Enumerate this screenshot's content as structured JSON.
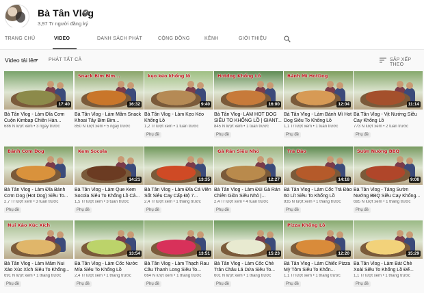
{
  "channel": {
    "name": "Bà Tân Vlog",
    "subscribers": "3,97 Tr người đăng ký",
    "verified_glyph": "✔"
  },
  "tabs": [
    {
      "label": "TRANG CHỦ"
    },
    {
      "label": "VIDEO"
    },
    {
      "label": "DANH SÁCH PHÁT"
    },
    {
      "label": "CỘNG ĐỒNG"
    },
    {
      "label": "KÊNH"
    },
    {
      "label": "GIỚI THIỆU"
    }
  ],
  "active_tab": "VIDEO",
  "subheader": {
    "uploads_label": "Video tải lên",
    "play_all": "PHÁT TẤT CẢ",
    "sort_label": "SẮP XẾP THEO"
  },
  "icons": {
    "search": "search-icon",
    "sort": "sort-icon",
    "dropdown": "caret-down-icon",
    "verified": "verified-check-icon"
  },
  "videos": [
    {
      "title": "Bà Tân Vlog - Làm Đĩa Cơm Cuộn Kimbap Chiên Hàn...",
      "meta": "686 N lượt xem • 3 ngày trước",
      "duration": "17:40",
      "badge": "",
      "caption": "",
      "bg": "#7aa36b",
      "food": "#8c8a4a"
    },
    {
      "title": "Bà Tân Vlog - Làm Mâm Snack Khoai Tây Bim Bim...",
      "meta": "850 N lượt xem • 5 ngày trước",
      "duration": "16:32",
      "badge": "",
      "caption": "Snack Bim Bim...",
      "bg": "#8aa56a",
      "food": "#c9762a"
    },
    {
      "title": "Bà Tân Vlog - Làm Kẹo Kéo Khổng Lồ",
      "meta": "1,2 Tr lượt xem • 1 tuần trước",
      "duration": "9:40",
      "badge": "Phụ đề",
      "caption": "kẹo kéo khổng lồ",
      "bg": "#9fbf83",
      "food": "#b58a55"
    },
    {
      "title": "Bà Tân Vlog- LÀM HOT DOG SIÊU TO KHỔNG LỒ | GIANT...",
      "meta": "845 N lượt xem • 1 tuần trước",
      "duration": "16:00",
      "badge": "Phụ đề",
      "caption": "Hotdog Khổng Lồ",
      "bg": "#5f8c54",
      "food": "#c77a3a"
    },
    {
      "title": "Bà Tân Vlog - Làm Bánh Mì Hot Dog Siêu To Khổng Lồ",
      "meta": "1,1 Tr lượt xem • 1 tuần trước",
      "duration": "12:04",
      "badge": "Phụ đề",
      "caption": "Bánh Mì    HotDog",
      "bg": "#7e9e5e",
      "food": "#d79a55"
    },
    {
      "title": "Bà Tân Vlog - Vịt Nướng Siêu Cay Khổng Lồ",
      "meta": "773 N lượt xem • 2 tuần trước",
      "duration": "11:14",
      "badge": "Phụ đề",
      "caption": "",
      "bg": "#86a86c",
      "food": "#a4502c"
    },
    {
      "title": "Bà Tân Vlog - Làm Đĩa Bánh Cơm Dog (Hot Dog) Siêu To...",
      "meta": "2,7 Tr lượt xem • 3 tuần trước",
      "duration": "",
      "badge": "Phụ đề",
      "caption": "Bánh Cơm Dog",
      "bg": "#7fa065",
      "food": "#d9923c"
    },
    {
      "title": "Bà Tân Vlog - Làm Que Kem Socola Siêu To Khổng Lồ Cả...",
      "meta": "1,5 Tr lượt xem • 3 tuần trước",
      "duration": "14:21",
      "badge": "Phụ đề",
      "caption": "Kem Socola",
      "bg": "#a5b88a",
      "food": "#6b3b22"
    },
    {
      "title": "Bà Tân Vlog - Làm Đĩa Cá Viên Sốt Siêu Cay Cấp Độ 7...",
      "meta": "2,4 Tr lượt xem • 1 tháng trước",
      "duration": "13:35",
      "badge": "Phụ đề",
      "caption": "",
      "bg": "#6f975a",
      "food": "#cf4a25"
    },
    {
      "title": "Bà Tân Vlog - Làm Đùi Gà Rán Chiên Giòn Siêu Nhỏ |...",
      "meta": "2,4 Tr lượt xem • 4 tuần trước",
      "duration": "12:27",
      "badge": "Phụ đề",
      "caption": "Gà Rán Siêu Nhỏ",
      "bg": "#98b27e",
      "food": "#b98a4c"
    },
    {
      "title": "Bà Tân Vlog - Làm Cốc Trà Đào 60 Lít Siêu To Khổng Lồ",
      "meta": "935 N lượt xem • 1 tháng trước",
      "duration": "14:18",
      "badge": "Phụ đề",
      "caption": "Trà Đào",
      "bg": "#5d8a4f",
      "food": "#b55a2a"
    },
    {
      "title": "Bà Tân Vlog - Tảng Sườn Nướng BBQ Siêu Cay Khổng...",
      "meta": "695 N lượt xem • 1 tháng trước",
      "duration": "9:08",
      "badge": "Phụ đề",
      "caption": "Sườn Nướng BBQ",
      "bg": "#789a61",
      "food": "#b0462a"
    },
    {
      "title": "Bà Tân Vlog - Làm Mâm Nui Xào Xúc Xích Siêu To Khổng...",
      "meta": "691 N lượt xem • 1 tháng trước",
      "duration": "",
      "badge": "Phụ đề",
      "caption": "Nui Xào   Xúc Xích",
      "bg": "#a0b98a",
      "food": "#e0b66a"
    },
    {
      "title": "Bà Tân Vlog - Làm Cốc Nước Mía Siêu To Khổng Lồ",
      "meta": "2,4 Tr lượt xem • 1 tháng trước",
      "duration": "13:54",
      "badge": "Phụ đề",
      "caption": "",
      "bg": "#7da46b",
      "food": "#bcd36a"
    },
    {
      "title": "Bà Tân Vlog - Làm Thạch Rau Câu Thanh Long Siêu To...",
      "meta": "664 N lượt xem • 1 tháng trước",
      "duration": "13:51",
      "badge": "Phụ đề",
      "caption": "",
      "bg": "#8fb079",
      "food": "#d8315a"
    },
    {
      "title": "Bà Tân Vlog - Làm Cốc Chè Trân Châu Lá Dứa Siêu To...",
      "meta": "601 N lượt xem • 1 tháng trước",
      "duration": "15:23",
      "badge": "Phụ đề",
      "caption": "",
      "bg": "#6e9a5e",
      "food": "#e8ead0"
    },
    {
      "title": "Bà Tân Vlog - Làm Chiếc Pizza Mỳ Tôm Siêu To Khổn...",
      "meta": "1,1 Tr lượt xem • 1 tháng trước",
      "duration": "12:20",
      "badge": "Phụ đề",
      "caption": "Pizza  Khổng Lồ",
      "bg": "#87a96f",
      "food": "#d98b3a"
    },
    {
      "title": "Bà Tân Vlog - Làm Bát Chè Xoài Siêu To Khổng Lồ Để...",
      "meta": "1,1 Tr lượt xem • 1 tháng trước",
      "duration": "15:29",
      "badge": "Phụ đề",
      "caption": "",
      "bg": "#9ab985",
      "food": "#f2d27a"
    }
  ]
}
